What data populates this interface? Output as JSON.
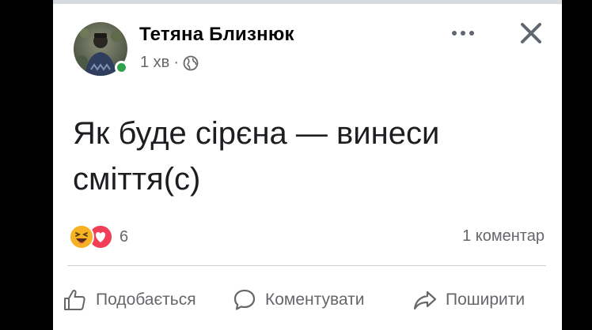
{
  "post": {
    "author": "Тетяна Близнюк",
    "time": "1 хв",
    "separator": "·",
    "text_line1": "Як буде сірєна — винеси",
    "text_line2": "сміття(с)",
    "reaction_count": "6",
    "comment_count": "1 коментар"
  },
  "actions": {
    "like_label": "Подобається",
    "comment_label": "Коментувати",
    "share_label": "Поширити"
  },
  "icons": {
    "privacy": "globe-icon",
    "more": "more-icon",
    "close": "close-icon",
    "reactions": [
      "haha-icon",
      "love-icon"
    ],
    "like": "thumbs-up-icon",
    "comment": "comment-bubble-icon",
    "share": "share-arrow-icon"
  },
  "colors": {
    "online": "#31a24c",
    "text_secondary": "#65676b",
    "haha": "#f7b125",
    "love": "#f33e58"
  }
}
